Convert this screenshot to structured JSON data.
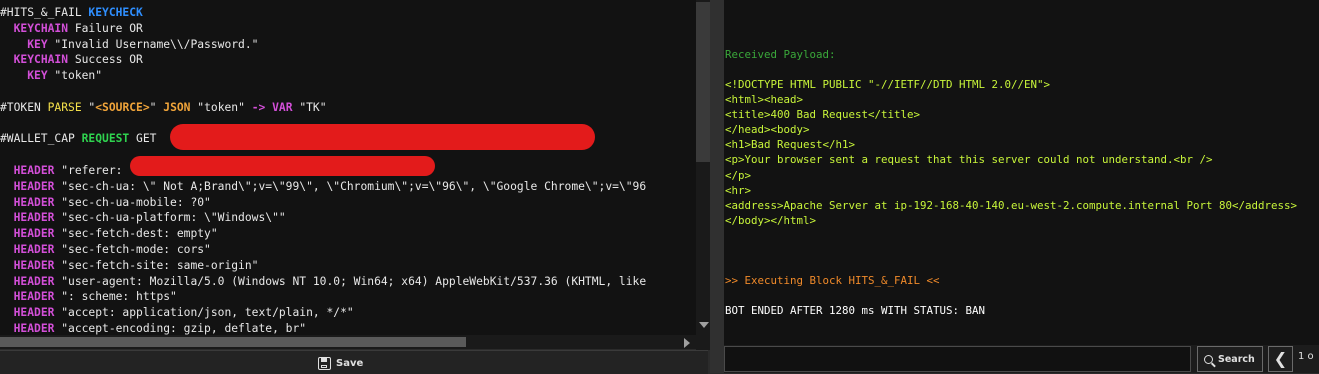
{
  "editor": {
    "lines": [
      {
        "parts": [
          {
            "t": "#HITS_&_FAIL ",
            "c": "plain"
          },
          {
            "t": "KEYCHECK",
            "c": "kw-blue"
          }
        ]
      },
      {
        "parts": [
          {
            "t": "  ",
            "c": "plain"
          },
          {
            "t": "KEYCHAIN",
            "c": "kw-purple"
          },
          {
            "t": " Failure OR",
            "c": "plain"
          }
        ]
      },
      {
        "parts": [
          {
            "t": "    ",
            "c": "plain"
          },
          {
            "t": "KEY",
            "c": "kw-purple"
          },
          {
            "t": " \"Invalid Username\\\\/Password.\"",
            "c": "plain"
          }
        ]
      },
      {
        "parts": [
          {
            "t": "  ",
            "c": "plain"
          },
          {
            "t": "KEYCHAIN",
            "c": "kw-purple"
          },
          {
            "t": " Success OR",
            "c": "plain"
          }
        ]
      },
      {
        "parts": [
          {
            "t": "    ",
            "c": "plain"
          },
          {
            "t": "KEY",
            "c": "kw-purple"
          },
          {
            "t": " \"token\"",
            "c": "plain"
          }
        ]
      },
      {
        "parts": []
      },
      {
        "parts": [
          {
            "t": "#TOKEN ",
            "c": "plain"
          },
          {
            "t": "PARSE",
            "c": "kw-yellow"
          },
          {
            "t": " \"",
            "c": "plain"
          },
          {
            "t": "<SOURCE>",
            "c": "kw-orange"
          },
          {
            "t": "\" ",
            "c": "plain"
          },
          {
            "t": "JSON",
            "c": "kw-orange"
          },
          {
            "t": " \"token\" ",
            "c": "plain"
          },
          {
            "t": "->",
            "c": "kw-purple"
          },
          {
            "t": " ",
            "c": "plain"
          },
          {
            "t": "VAR",
            "c": "kw-purple"
          },
          {
            "t": " \"TK\"",
            "c": "plain"
          }
        ]
      },
      {
        "parts": []
      },
      {
        "parts": [
          {
            "t": "#WALLET_CAP ",
            "c": "plain"
          },
          {
            "t": "REQUEST",
            "c": "kw-green"
          },
          {
            "t": " GET",
            "c": "plain"
          }
        ]
      },
      {
        "parts": []
      },
      {
        "parts": [
          {
            "t": "  ",
            "c": "plain"
          },
          {
            "t": "HEADER",
            "c": "kw-purple"
          },
          {
            "t": " \"referer:",
            "c": "plain"
          }
        ]
      },
      {
        "parts": [
          {
            "t": "  ",
            "c": "plain"
          },
          {
            "t": "HEADER",
            "c": "kw-purple"
          },
          {
            "t": " \"sec-ch-ua: \\\" Not A;Brand\\\";v=\\\"99\\\", \\\"Chromium\\\";v=\\\"96\\\", \\\"Google Chrome\\\";v=\\\"96",
            "c": "plain"
          }
        ]
      },
      {
        "parts": [
          {
            "t": "  ",
            "c": "plain"
          },
          {
            "t": "HEADER",
            "c": "kw-purple"
          },
          {
            "t": " \"sec-ch-ua-mobile: ?0\"",
            "c": "plain"
          }
        ]
      },
      {
        "parts": [
          {
            "t": "  ",
            "c": "plain"
          },
          {
            "t": "HEADER",
            "c": "kw-purple"
          },
          {
            "t": " \"sec-ch-ua-platform: \\\"Windows\\\"\"",
            "c": "plain"
          }
        ]
      },
      {
        "parts": [
          {
            "t": "  ",
            "c": "plain"
          },
          {
            "t": "HEADER",
            "c": "kw-purple"
          },
          {
            "t": " \"sec-fetch-dest: empty\"",
            "c": "plain"
          }
        ]
      },
      {
        "parts": [
          {
            "t": "  ",
            "c": "plain"
          },
          {
            "t": "HEADER",
            "c": "kw-purple"
          },
          {
            "t": " \"sec-fetch-mode: cors\"",
            "c": "plain"
          }
        ]
      },
      {
        "parts": [
          {
            "t": "  ",
            "c": "plain"
          },
          {
            "t": "HEADER",
            "c": "kw-purple"
          },
          {
            "t": " \"sec-fetch-site: same-origin\"",
            "c": "plain"
          }
        ]
      },
      {
        "parts": [
          {
            "t": "  ",
            "c": "plain"
          },
          {
            "t": "HEADER",
            "c": "kw-purple"
          },
          {
            "t": " \"user-agent: Mozilla/5.0 (Windows NT 10.0; Win64; x64) AppleWebKit/537.36 (KHTML, like",
            "c": "plain"
          }
        ]
      },
      {
        "parts": [
          {
            "t": "  ",
            "c": "plain"
          },
          {
            "t": "HEADER",
            "c": "kw-purple"
          },
          {
            "t": " \": scheme: https\"",
            "c": "plain"
          }
        ]
      },
      {
        "parts": [
          {
            "t": "  ",
            "c": "plain"
          },
          {
            "t": "HEADER",
            "c": "kw-purple"
          },
          {
            "t": " \"accept: application/json, text/plain, */*\"",
            "c": "plain"
          }
        ]
      },
      {
        "parts": [
          {
            "t": "  ",
            "c": "plain"
          },
          {
            "t": "HEADER",
            "c": "kw-purple"
          },
          {
            "t": " \"accept-encoding: gzip, deflate, br\"",
            "c": "plain"
          }
        ]
      }
    ],
    "redaction_color": "#e31b1b"
  },
  "savebar": {
    "save_label": "Save"
  },
  "log": {
    "lines": [
      {
        "t": "",
        "c": "log-green"
      },
      {
        "t": "",
        "c": "log-green"
      },
      {
        "t": "Received Payload:",
        "c": "log-green"
      },
      {
        "t": "",
        "c": "log-green"
      },
      {
        "t": "<!DOCTYPE HTML PUBLIC \"-//IETF//DTD HTML 2.0//EN\">",
        "c": "log-lime"
      },
      {
        "t": "<html><head>",
        "c": "log-lime"
      },
      {
        "t": "<title>400 Bad Request</title>",
        "c": "log-lime"
      },
      {
        "t": "</head><body>",
        "c": "log-lime"
      },
      {
        "t": "<h1>Bad Request</h1>",
        "c": "log-lime"
      },
      {
        "t": "<p>Your browser sent a request that this server could not understand.<br />",
        "c": "log-lime"
      },
      {
        "t": "</p>",
        "c": "log-lime"
      },
      {
        "t": "<hr>",
        "c": "log-lime"
      },
      {
        "t": "<address>Apache Server at ip-192-168-40-140.eu-west-2.compute.internal Port 80</address>",
        "c": "log-lime"
      },
      {
        "t": "</body></html>",
        "c": "log-lime"
      },
      {
        "t": "",
        "c": "log-lime"
      },
      {
        "t": "",
        "c": "log-lime"
      },
      {
        "t": "",
        "c": "log-lime"
      },
      {
        "t": ">> Executing Block HITS_&_FAIL <<",
        "c": "log-orange"
      },
      {
        "t": "",
        "c": "log-white"
      },
      {
        "t": "BOT ENDED AFTER 1280 ms WITH STATUS: BAN",
        "c": "log-white"
      }
    ]
  },
  "search": {
    "placeholder": "",
    "button_label": "Search",
    "prev_label": "❮",
    "counter": "1 o"
  },
  "colors": {
    "editor_bg": "#121212",
    "keyword_purple": "#d34fd8",
    "keyword_blue": "#2f8fff",
    "keyword_green": "#2fd34f",
    "keyword_orange": "#f0a43a",
    "log_lime": "#c8f53a",
    "log_green": "#3aa83a",
    "log_orange": "#f08a2a"
  }
}
